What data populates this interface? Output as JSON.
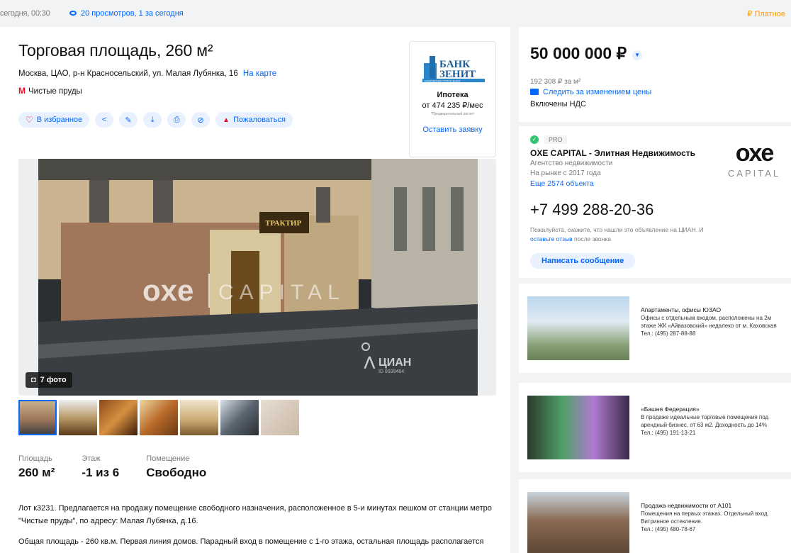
{
  "topbar": {
    "date": "сегодня, 00:30",
    "views": "20 просмотров, 1 за сегодня",
    "paid": "₽ Платное"
  },
  "listing": {
    "title": "Торговая площадь, 260 м²",
    "address": "Москва, ЦАО, р-н Красносельский, ул. Малая Лубянка, 16",
    "map_link": "На карте",
    "metro_symbol": "М",
    "metro": "Чистые пруды"
  },
  "actions": {
    "favorite": "В избранное",
    "report": "Пожаловаться",
    "icons": [
      "share-icon",
      "edit-icon",
      "download-icon",
      "print-icon",
      "hide-icon"
    ]
  },
  "bank": {
    "name_line1": "БАНК",
    "name_line2": "ЗЕНИТ",
    "name_line3": "БАНКОВСКАЯ ГРУППА ЗЕНИТ",
    "mortgage": "Ипотека",
    "rate": "от 474 235 ₽/мес",
    "note": "*Предварительный расчет",
    "request": "Оставить заявку"
  },
  "gallery": {
    "photo_count": "7 фото",
    "watermark_brand": "CAPITAL",
    "cian": "ЦИАН",
    "cian_id": "ID 6939464",
    "sign": "ТРАКТИР"
  },
  "facts": [
    {
      "label": "Площадь",
      "value": "260 м²"
    },
    {
      "label": "Этаж",
      "value": "-1 из 6"
    },
    {
      "label": "Помещение",
      "value": "Свободно"
    }
  ],
  "description": {
    "p1": "Лот к3231. Предлагается на продажу помещение свободного назначения, расположенное в 5-и минутах пешком от станции метро \"Чистые пруды\", по адресу: Малая Лубянка, д.16.",
    "p2": "Общая площадь - 260 кв.м. Первая линия домов. Парадный вход в помещение с 1-го этажа, остальная площадь располагается"
  },
  "price": {
    "value": "50 000 000 ₽",
    "per_sqm": "192 308 ₽ за м²",
    "follow": "Следить за изменением цены",
    "vat": "Включены НДС"
  },
  "agent": {
    "tag": "PRO",
    "name": "OXE CAPITAL - Элитная Недвижимость",
    "kind": "Агентство недвижимости",
    "since": "На рынке с 2017 года",
    "more": "Еще 2574 объекта",
    "logo_word": "oxe",
    "logo_sub": "CAPITAL",
    "phone": "+7 499 288-20-36",
    "hint_a": "Пожалуйста, скажите, что нашли это объявление на ЦИАН. И ",
    "hint_link": "оставьте отзыв",
    "hint_b": " после звонка",
    "write": "Написать сообщение"
  },
  "ads": [
    {
      "title": "Апартаменты, офисы ЮЗАО",
      "text": "Офисы с отдельным входом, расположены на 2м этаже ЖК «Айвазовский» недалеко от м. Каховская",
      "phone": "Тел.: (495) 287-88-88"
    },
    {
      "title": "«Башня Федерация»",
      "text": "В продаже идеальные торговые помещения под арендный бизнес, от 63 м2. Доходность до 14%",
      "phone": "Тел.: (495) 191-13-21"
    },
    {
      "title": "Продажа недвижимости от А101",
      "text": "Помещения на первых этажах. Отдельный вход. Витринное остекление.",
      "phone": "Тел.: (495) 480-78-67"
    }
  ],
  "colors": {
    "accent": "#0468ff",
    "metro": "#e8112d",
    "paid": "#ff9d00",
    "pill_bg": "#e9f1ff"
  }
}
